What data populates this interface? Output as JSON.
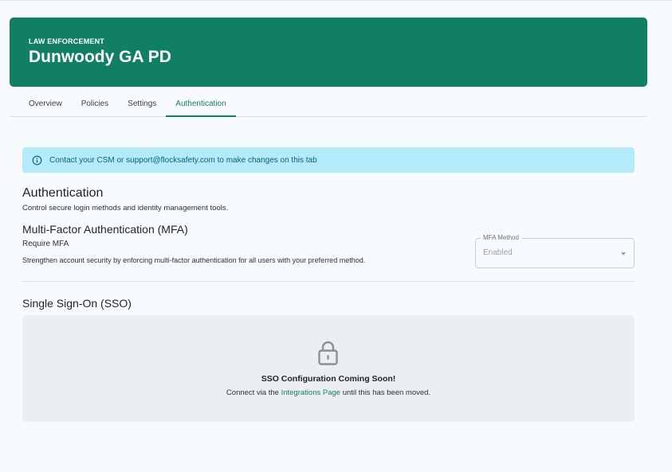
{
  "header": {
    "eyebrow": "LAW ENFORCEMENT",
    "title": "Dunwoody GA PD",
    "color": "#107f63"
  },
  "tabs": [
    {
      "label": "Overview",
      "active": false
    },
    {
      "label": "Policies",
      "active": false
    },
    {
      "label": "Settings",
      "active": false
    },
    {
      "label": "Authentication",
      "active": true
    }
  ],
  "banner": {
    "icon": "info-icon",
    "text": "Contact your CSM or support@flocksafety.com to make changes on this tab"
  },
  "authentication": {
    "title": "Authentication",
    "subtitle": "Control secure login methods and identity management tools."
  },
  "mfa": {
    "title": "Multi-Factor Authentication (MFA)",
    "require_label": "Require MFA",
    "description": "Strengthen account security by enforcing multi-factor authentication for all users with your preferred method.",
    "select_label": "MFA Method",
    "select_value": "Enabled"
  },
  "sso": {
    "title": "Single Sign-On (SSO)",
    "icon": "lock-icon",
    "coming_soon": "SSO Configuration Coming Soon!",
    "connect_prefix": "Connect via the ",
    "connect_link": "Integrations Page",
    "connect_suffix": " until this has been moved."
  }
}
